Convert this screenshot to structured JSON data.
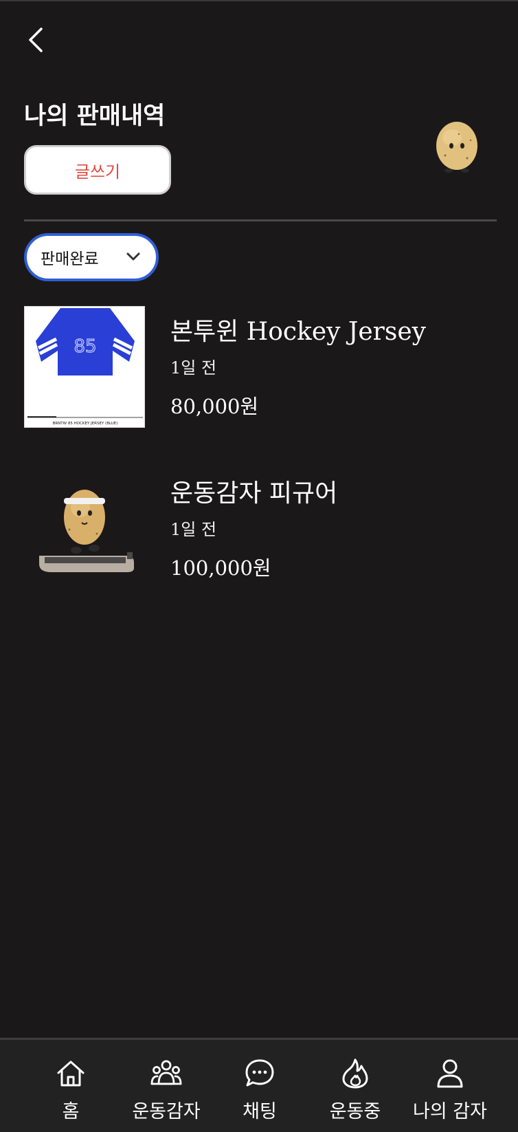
{
  "header": {
    "back_icon": "chevron-left-icon",
    "title": "나의 판매내역",
    "write_label": "글쓰기"
  },
  "filter": {
    "selected": "판매완료",
    "icon": "chevron-down-icon"
  },
  "items": [
    {
      "title": "본투윈 Hockey Jersey",
      "time": "1일 전",
      "price": "80,000원",
      "thumb_caption": "BRNTW 85 HOCKEY JERSEY (BLUE)",
      "jersey_number": "85"
    },
    {
      "title": "운동감자 피규어",
      "time": "1일 전",
      "price": "100,000원"
    }
  ],
  "nav": [
    {
      "label": "홈",
      "icon": "home-icon"
    },
    {
      "label": "운동감자",
      "icon": "group-icon"
    },
    {
      "label": "채팅",
      "icon": "chat-icon"
    },
    {
      "label": "운동중",
      "icon": "flame-icon"
    },
    {
      "label": "나의 감자",
      "icon": "person-icon"
    }
  ],
  "colors": {
    "background": "#1b1819",
    "accent_red": "#e04a3f",
    "accent_blue": "#2f5fd6",
    "jersey_blue": "#2a3fd6"
  }
}
